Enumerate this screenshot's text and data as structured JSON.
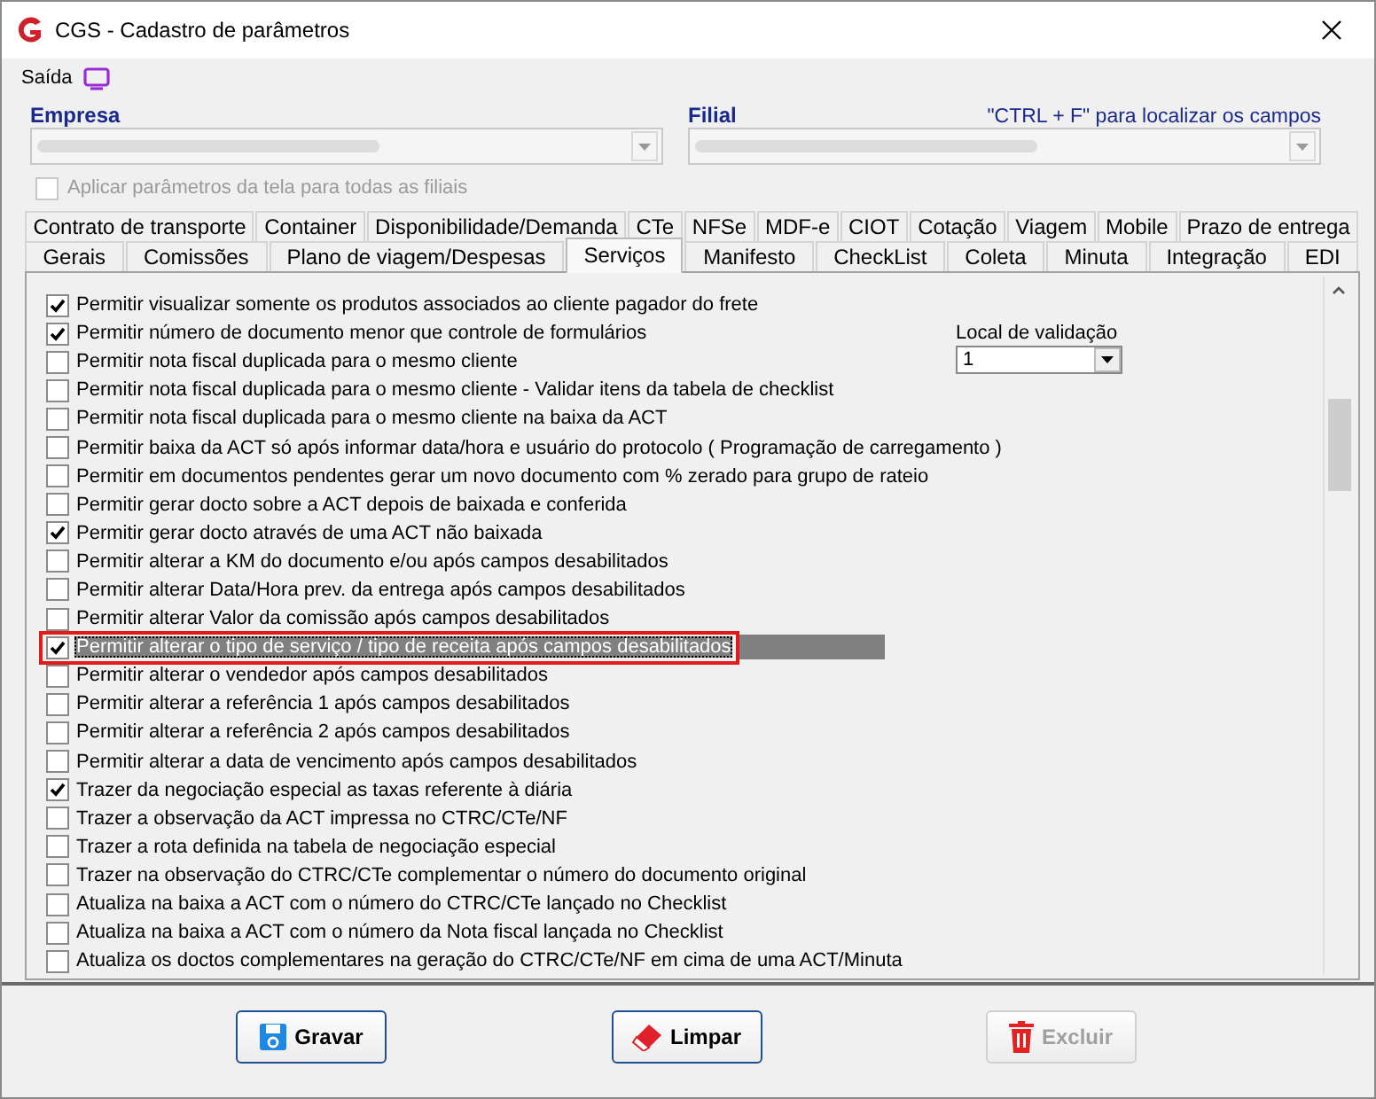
{
  "window": {
    "title": "CGS - Cadastro de parâmetros"
  },
  "menu": {
    "label": "Saída"
  },
  "empresa": {
    "label": "Empresa"
  },
  "filial": {
    "label": "Filial"
  },
  "hint": "\"CTRL + F\" para localizar os campos",
  "apply_all": {
    "label": "Aplicar parâmetros da tela para todas as filiais",
    "checked": false,
    "disabled": true
  },
  "tab_rows": [
    [
      {
        "label": "Contrato de transporte",
        "selected": false
      },
      {
        "label": "Container",
        "selected": false
      },
      {
        "label": "Disponibilidade/Demanda",
        "selected": false
      },
      {
        "label": "CTe",
        "selected": false
      },
      {
        "label": "NFSe",
        "selected": false
      },
      {
        "label": "MDF-e",
        "selected": false
      },
      {
        "label": "CIOT",
        "selected": false
      },
      {
        "label": "Cotação",
        "selected": false
      },
      {
        "label": "Viagem",
        "selected": false
      },
      {
        "label": "Mobile",
        "selected": false
      },
      {
        "label": "Prazo de entrega",
        "selected": false
      }
    ],
    [
      {
        "label": "Gerais",
        "selected": false
      },
      {
        "label": "Comissões",
        "selected": false
      },
      {
        "label": "Plano de viagem/Despesas",
        "selected": false
      },
      {
        "label": "Serviços",
        "selected": true
      },
      {
        "label": "Manifesto",
        "selected": false
      },
      {
        "label": "CheckList",
        "selected": false
      },
      {
        "label": "Coleta",
        "selected": false
      },
      {
        "label": "Minuta",
        "selected": false
      },
      {
        "label": "Integração",
        "selected": false
      },
      {
        "label": "EDI",
        "selected": false
      }
    ]
  ],
  "options": [
    {
      "label": "Permitir visualizar somente os produtos associados ao cliente pagador do frete",
      "checked": true,
      "selected": false
    },
    {
      "label": "Permitir número de documento menor que controle de formulários",
      "checked": true,
      "selected": false
    },
    {
      "label": "Permitir nota fiscal duplicada para o mesmo cliente",
      "checked": false,
      "selected": false
    },
    {
      "label": "Permitir nota fiscal duplicada para o mesmo cliente - Validar itens da tabela de checklist",
      "checked": false,
      "selected": false
    },
    {
      "label": "Permitir nota fiscal duplicada para o mesmo cliente na baixa da ACT",
      "checked": false,
      "selected": false
    },
    {
      "label": "Permitir baixa da ACT só após informar data/hora e usuário do protocolo ( Programação de carregamento )",
      "checked": false,
      "selected": false
    },
    {
      "label": "Permitir em documentos pendentes gerar um novo documento com % zerado para grupo de rateio",
      "checked": false,
      "selected": false
    },
    {
      "label": "Permitir gerar docto sobre a ACT depois de baixada e conferida",
      "checked": false,
      "selected": false
    },
    {
      "label": "Permitir gerar docto através de uma ACT não baixada",
      "checked": true,
      "selected": false
    },
    {
      "label": "Permitir alterar a KM do documento e/ou após campos desabilitados",
      "checked": false,
      "selected": false
    },
    {
      "label": "Permitir alterar Data/Hora prev. da entrega após campos desabilitados",
      "checked": false,
      "selected": false
    },
    {
      "label": "Permitir alterar Valor da comissão após campos desabilitados",
      "checked": false,
      "selected": false
    },
    {
      "label": "Permitir alterar o tipo de serviço / tipo de receita após campos desabilitados",
      "checked": true,
      "selected": true
    },
    {
      "label": "Permitir alterar o vendedor após campos desabilitados",
      "checked": false,
      "selected": false
    },
    {
      "label": "Permitir alterar a referência 1 após campos desabilitados",
      "checked": false,
      "selected": false
    },
    {
      "label": "Permitir alterar a referência 2 após campos desabilitados",
      "checked": false,
      "selected": false
    },
    {
      "label": "Permitir alterar a data de vencimento após campos desabilitados",
      "checked": false,
      "selected": false
    },
    {
      "label": "Trazer da negociação especial as taxas referente à diária",
      "checked": true,
      "selected": false
    },
    {
      "label": "Trazer a observação da ACT impressa no CTRC/CTe/NF",
      "checked": false,
      "selected": false
    },
    {
      "label": "Trazer a rota definida na tabela de negociação especial",
      "checked": false,
      "selected": false
    },
    {
      "label": "Trazer na observação do CTRC/CTe complementar o número do documento original",
      "checked": false,
      "selected": false
    },
    {
      "label": "Atualiza na baixa a ACT com o número do CTRC/CTe lançado no Checklist",
      "checked": false,
      "selected": false
    },
    {
      "label": "Atualiza na baixa a ACT com o número da Nota fiscal lançada no Checklist",
      "checked": false,
      "selected": false
    },
    {
      "label": "Atualiza os doctos complementares na geração do CTRC/CTe/NF em cima de uma ACT/Minuta",
      "checked": false,
      "selected": false
    }
  ],
  "validation": {
    "label": "Local de validação",
    "value": "1"
  },
  "buttons": [
    {
      "label": "Gravar",
      "kind": "save",
      "disabled": false
    },
    {
      "label": "Limpar",
      "kind": "clear",
      "disabled": false
    },
    {
      "label": "Excluir",
      "kind": "delete",
      "disabled": true
    }
  ]
}
